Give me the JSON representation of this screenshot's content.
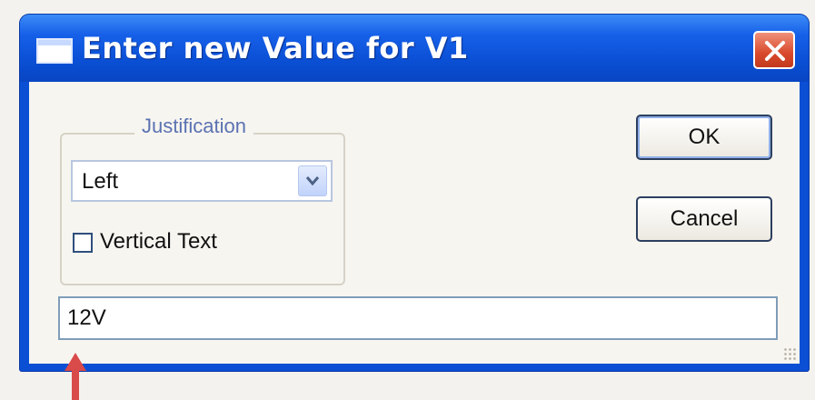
{
  "window": {
    "title": "Enter new Value for V1",
    "icon": "window-icon",
    "close_icon": "close-icon"
  },
  "justification": {
    "group_label": "Justification",
    "selected": "Left",
    "dropdown_icon": "chevron-down-icon"
  },
  "vertical_text": {
    "label": "Vertical Text",
    "checked": false
  },
  "buttons": {
    "ok": "OK",
    "cancel": "Cancel"
  },
  "value_field": {
    "value": "12V"
  },
  "annotation": {
    "icon": "arrow-up-icon",
    "color": "#d94a4a"
  },
  "colors": {
    "title_bar": "#0a4fd4",
    "close_button": "#d9492b"
  }
}
